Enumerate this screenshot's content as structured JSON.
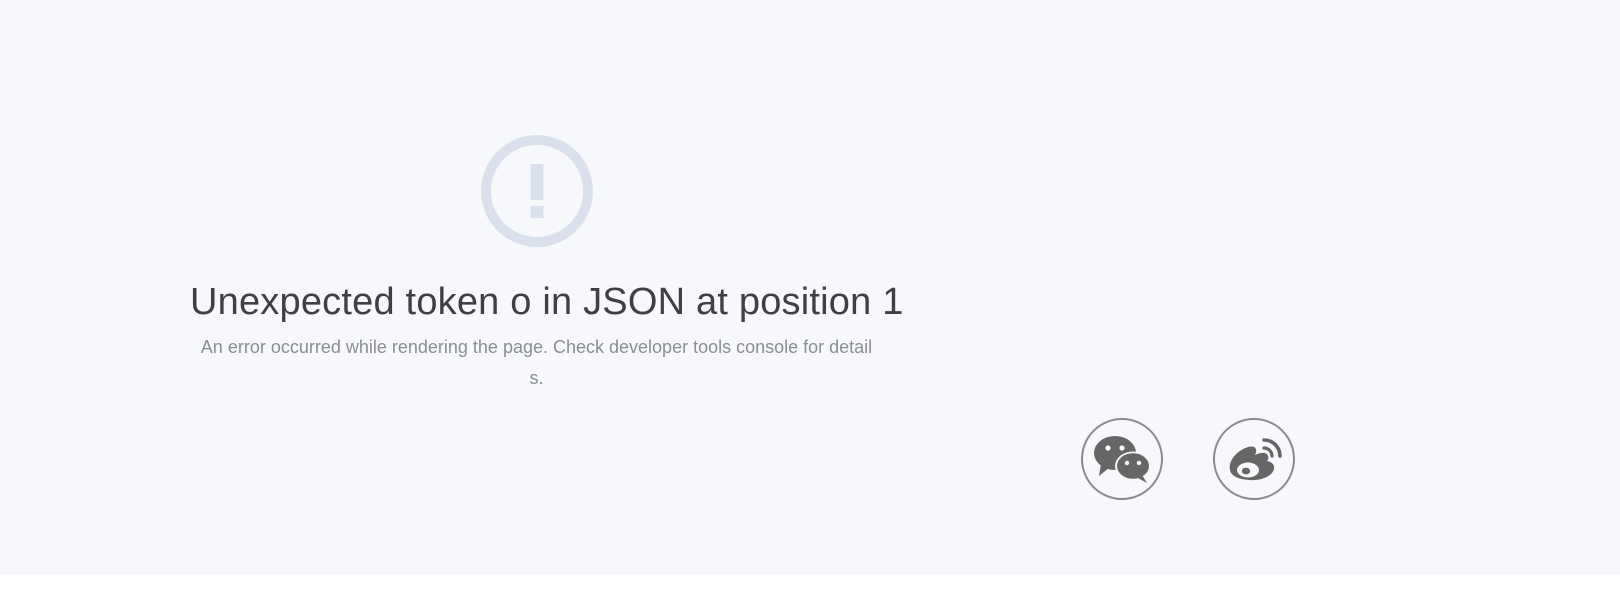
{
  "error": {
    "icon": "exclamation-circle-icon",
    "title": "Unexpected token o in JSON at position 1",
    "description": "An error occurred while rendering the page. Check developer tools console for details."
  },
  "social": [
    {
      "name": "WeChat",
      "icon": "wechat-icon"
    },
    {
      "name": "Weibo",
      "icon": "weibo-icon"
    }
  ],
  "colors": {
    "background": "#f7f8fb",
    "icon_muted": "#dbe1ec",
    "title": "#3f3f45",
    "description": "#8b8d94",
    "social": "#666666",
    "social_border": "#8b8b8b"
  }
}
